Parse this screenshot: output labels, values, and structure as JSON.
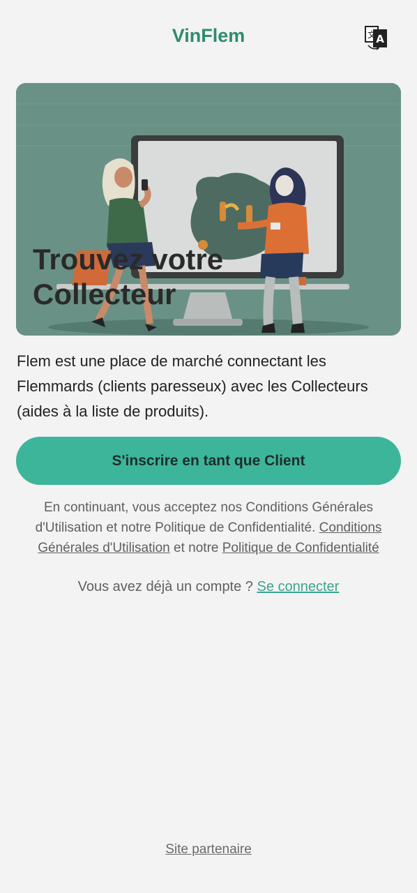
{
  "header": {
    "title": "VinFlem",
    "translate_icon": "translate-icon"
  },
  "hero": {
    "title_line1": "Trouvez votre",
    "title_line2": "Collecteur",
    "illustration": "marketplace-illustration"
  },
  "description": "Flem est une place de marché connectant les Flemmards (clients paresseux) avec les Collecteurs (aides à la liste de produits).",
  "cta": {
    "label": "S'inscrire en tant que Client"
  },
  "terms": {
    "prefix": "En continuant, vous acceptez nos Conditions Générales d'Utilisation et notre Politique de Confidentialité.",
    "link_cgu": "Conditions Générales d'Utilisation",
    "middle": "et notre",
    "link_privacy": "Politique de Confidentialité"
  },
  "login": {
    "prompt": "Vous avez déjà un compte ?",
    "link": "Se connecter"
  },
  "footer": {
    "partner_link": "Site partenaire"
  },
  "colors": {
    "brand": "#2e8b6f",
    "button": "#3db59a",
    "link": "#3aa58c",
    "background": "#f3f3f3"
  }
}
